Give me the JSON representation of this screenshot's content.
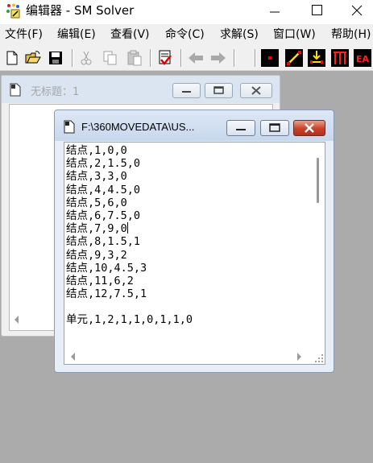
{
  "app": {
    "title": "编辑器 - SM Solver"
  },
  "menu": [
    {
      "label": "文件(F)"
    },
    {
      "label": "编辑(E)"
    },
    {
      "label": "查看(V)"
    },
    {
      "label": "命令(C)"
    },
    {
      "label": "求解(S)"
    },
    {
      "label": "窗口(W)"
    },
    {
      "label": "帮助(H)"
    }
  ],
  "toolbar": {
    "buttons": [
      "new-icon",
      "open-icon",
      "save-icon",
      "cut-icon",
      "copy-icon",
      "paste-icon",
      "check-icon",
      "back-icon",
      "forward-icon",
      "node-icon",
      "element-icon",
      "load-icon",
      "bar-icon"
    ],
    "ea_label": "EA"
  },
  "window_back": {
    "title": "无标题：1"
  },
  "window_front": {
    "title": "F:\\360MOVEDATA\\US...",
    "lines": [
      "结点,1,0,0",
      "结点,2,1.5,0",
      "结点,3,3,0",
      "结点,4,4.5,0",
      "结点,5,6,0",
      "结点,6,7.5,0",
      "结点,7,9,0",
      "结点,8,1.5,1",
      "结点,9,3,2",
      "结点,10,4.5,3",
      "结点,11,6,2",
      "结点,12,7.5,1",
      "",
      "单元,1,2,1,1,0,1,1,0"
    ]
  },
  "colors": {
    "close_red": "#c8402a",
    "accent_red": "#ff0000"
  }
}
